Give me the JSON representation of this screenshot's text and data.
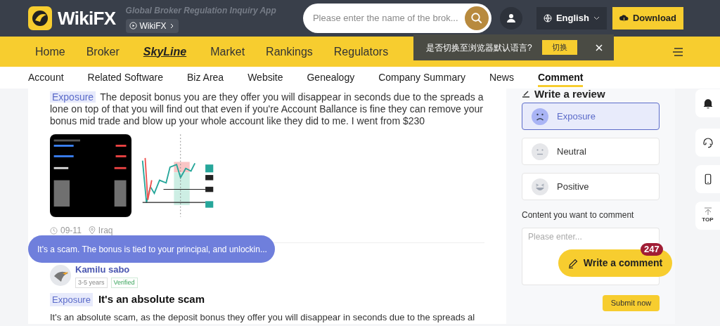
{
  "header": {
    "logo_text": "WikiFX",
    "tagline": "Global Broker Regulation Inquiry App",
    "app_chip": "WikiFX",
    "search": {
      "placeholder": "Please enter the name of the brok..."
    },
    "language": "English",
    "download": "Download"
  },
  "nav": {
    "items": [
      {
        "label": "Home",
        "kind": "text"
      },
      {
        "label": "Broker",
        "kind": "text"
      },
      {
        "label": "SkyLine",
        "kind": "logo"
      },
      {
        "label": "Market",
        "kind": "text"
      },
      {
        "label": "Rankings",
        "kind": "text"
      },
      {
        "label": "Regulators",
        "kind": "text"
      }
    ]
  },
  "language_toast": {
    "text": "是否切换至浏览器默认语言?",
    "button": "切换"
  },
  "subnav": {
    "items": [
      {
        "label": "Account",
        "selected": false
      },
      {
        "label": "Related Software",
        "selected": false
      },
      {
        "label": "Biz Area",
        "selected": false
      },
      {
        "label": "Website",
        "selected": false
      },
      {
        "label": "Genealogy",
        "selected": false
      },
      {
        "label": "Company Summary",
        "selected": false
      },
      {
        "label": "News",
        "selected": false
      },
      {
        "label": "Comment",
        "selected": true
      }
    ]
  },
  "posts": [
    {
      "tag": "Exposure",
      "body": "The deposit bonus you are they offer you will disappear in seconds due to the spreads alone on top of that you will find out that even if you're Account Ballance is fine they can remove your bonus mid trade and blow up your whole account like they did to me. I went from $230",
      "date": "09-11",
      "location": "Iraq"
    },
    {
      "author": "Kamilu sabo",
      "badges": [
        "3-5 years",
        "Verified"
      ],
      "tag": "Exposure",
      "title": "It's an absolute scam",
      "body": "It's an absolute scam, as the deposit bonus they offer you will disappear in seconds due to the spreads al"
    }
  ],
  "tooltip": "It's a scam. The bonus is tied to your principal, and unlockin...",
  "review": {
    "title": "Write a review",
    "options": [
      {
        "label": "Exposure",
        "kind": "sad",
        "selected": true
      },
      {
        "label": "Neutral",
        "kind": "neutral",
        "selected": false
      },
      {
        "label": "Positive",
        "kind": "happy",
        "selected": false
      }
    ],
    "content_label": "Content you want to comment",
    "placeholder": "Please enter...",
    "submit": "Submit now"
  },
  "fab": {
    "label": "Write a comment",
    "count": "247"
  },
  "side_tools": [
    {
      "kind": "bell"
    },
    {
      "kind": "headset"
    },
    {
      "kind": "phone"
    },
    {
      "kind": "top",
      "label": "TOP"
    }
  ]
}
